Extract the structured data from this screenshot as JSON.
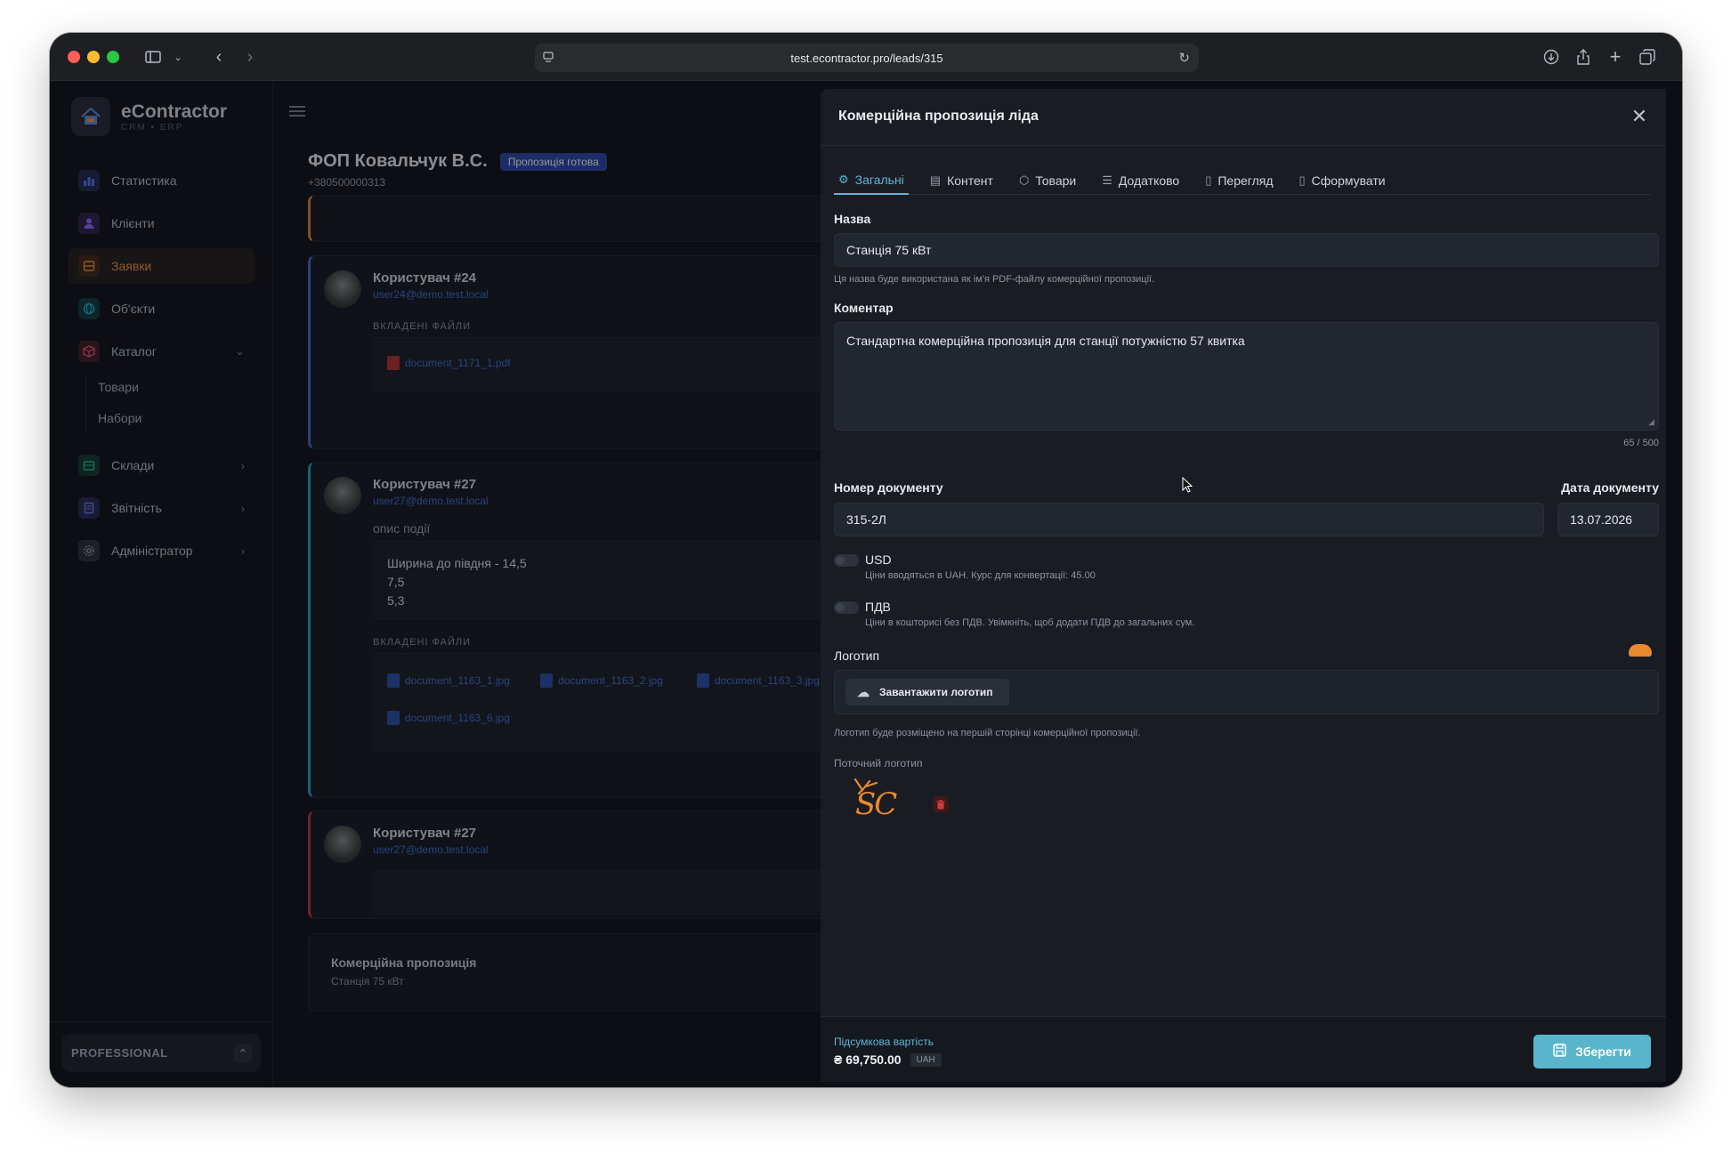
{
  "browser": {
    "url": "test.econtractor.pro/leads/315"
  },
  "sidebar": {
    "brand_name": "eContractor",
    "brand_sub": "CRM • ERP",
    "items": [
      {
        "label": "Статистика"
      },
      {
        "label": "Клієнти"
      },
      {
        "label": "Заявки"
      },
      {
        "label": "Об'єкти"
      },
      {
        "label": "Каталог"
      },
      {
        "label": "Товари"
      },
      {
        "label": "Набори"
      },
      {
        "label": "Склади"
      },
      {
        "label": "Звітність"
      },
      {
        "label": "Адміністратор"
      }
    ],
    "plan": "PROFESSIONAL"
  },
  "lead": {
    "name": "ФОП Ковальчук В.С.",
    "badge": "Пропозиція готова",
    "phone": "+380500000313",
    "events": [
      {
        "user": "Користувач #24",
        "email": "user24@demo.test.local",
        "section": "ВКЛАДЕНІ ФАЙЛИ",
        "files": [
          "document_1171_1.pdf"
        ]
      },
      {
        "user": "Користувач #27",
        "email": "user27@demo.test.local",
        "desc_label": "опис події",
        "desc_lines": [
          "Ширина до півдня - 14,5",
          "7,5",
          "5,3"
        ],
        "section": "ВКЛАДЕНІ ФАЙЛИ",
        "files": [
          "document_1163_1.jpg",
          "document_1163_2.jpg",
          "document_1163_3.jpg",
          "document_1163_6.jpg"
        ]
      },
      {
        "user": "Користувач #27",
        "email": "user27@demo.test.local"
      }
    ],
    "proposal_title": "Комерційна пропозиція",
    "proposal_sub": "Станція 75 кВт"
  },
  "panel": {
    "title": "Комерційна пропозиція ліда",
    "tabs": [
      {
        "label": "Загальні"
      },
      {
        "label": "Контент"
      },
      {
        "label": "Товари"
      },
      {
        "label": "Додатково"
      },
      {
        "label": "Перегляд"
      },
      {
        "label": "Сформувати"
      }
    ],
    "name_label": "Назва",
    "name_value": "Станція 75 кВт",
    "name_hint": "Ця назва буде використана як ім'я PDF-файлу комерційної пропозиції.",
    "comment_label": "Коментар",
    "comment_value": "Стандартна комерційна пропозиція для станції потужністю 57 квитка",
    "comment_count": "65 / 500",
    "docnum_label": "Номер документу",
    "docnum_value": "315-2Л",
    "docdate_label": "Дата документу",
    "docdate_value": "13.07.2026",
    "usd_label": "USD",
    "usd_hint": "Ціни вводяться в UAH. Курс для конвертації: 45.00",
    "vat_label": "ПДВ",
    "vat_hint": "Ціни в кошторисі без ПДВ. Увімкніть, щоб додати ПДВ до загальних сум.",
    "logo_label": "Логотип",
    "upload_label": "Завантажити логотип",
    "logo_hint": "Логотип буде розміщено на першій сторінці комерційної пропозиції.",
    "current_logo_label": "Поточний логотип",
    "logo_text": "SC",
    "total_label": "Підсумкова вартість",
    "total_value": "₴ 69,750.00",
    "currency": "UAH",
    "save_label": "Зберегти"
  }
}
